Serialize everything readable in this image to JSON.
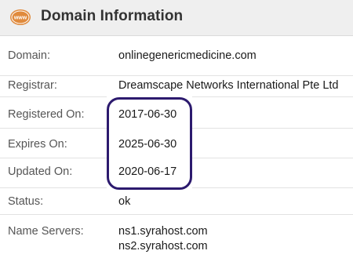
{
  "header": {
    "title": "Domain Information",
    "icon": "www-globe-icon",
    "icon_text": "www",
    "icon_color": "#e08a3c"
  },
  "rows": [
    {
      "label": "Domain:",
      "value": "onlinegenericmedicine.com"
    },
    {
      "label": "Registrar:",
      "value": "Dreamscape Networks International Pte Ltd"
    },
    {
      "label": "Registered On:",
      "value": "2017-06-30"
    },
    {
      "label": "Expires On:",
      "value": "2025-06-30"
    },
    {
      "label": "Updated On:",
      "value": "2020-06-17"
    },
    {
      "label": "Status:",
      "value": "ok"
    },
    {
      "label": "Name Servers:",
      "values": [
        "ns1.syrahost.com",
        "ns2.syrahost.com"
      ]
    }
  ],
  "annotation": {
    "color": "#2c1a6e"
  }
}
